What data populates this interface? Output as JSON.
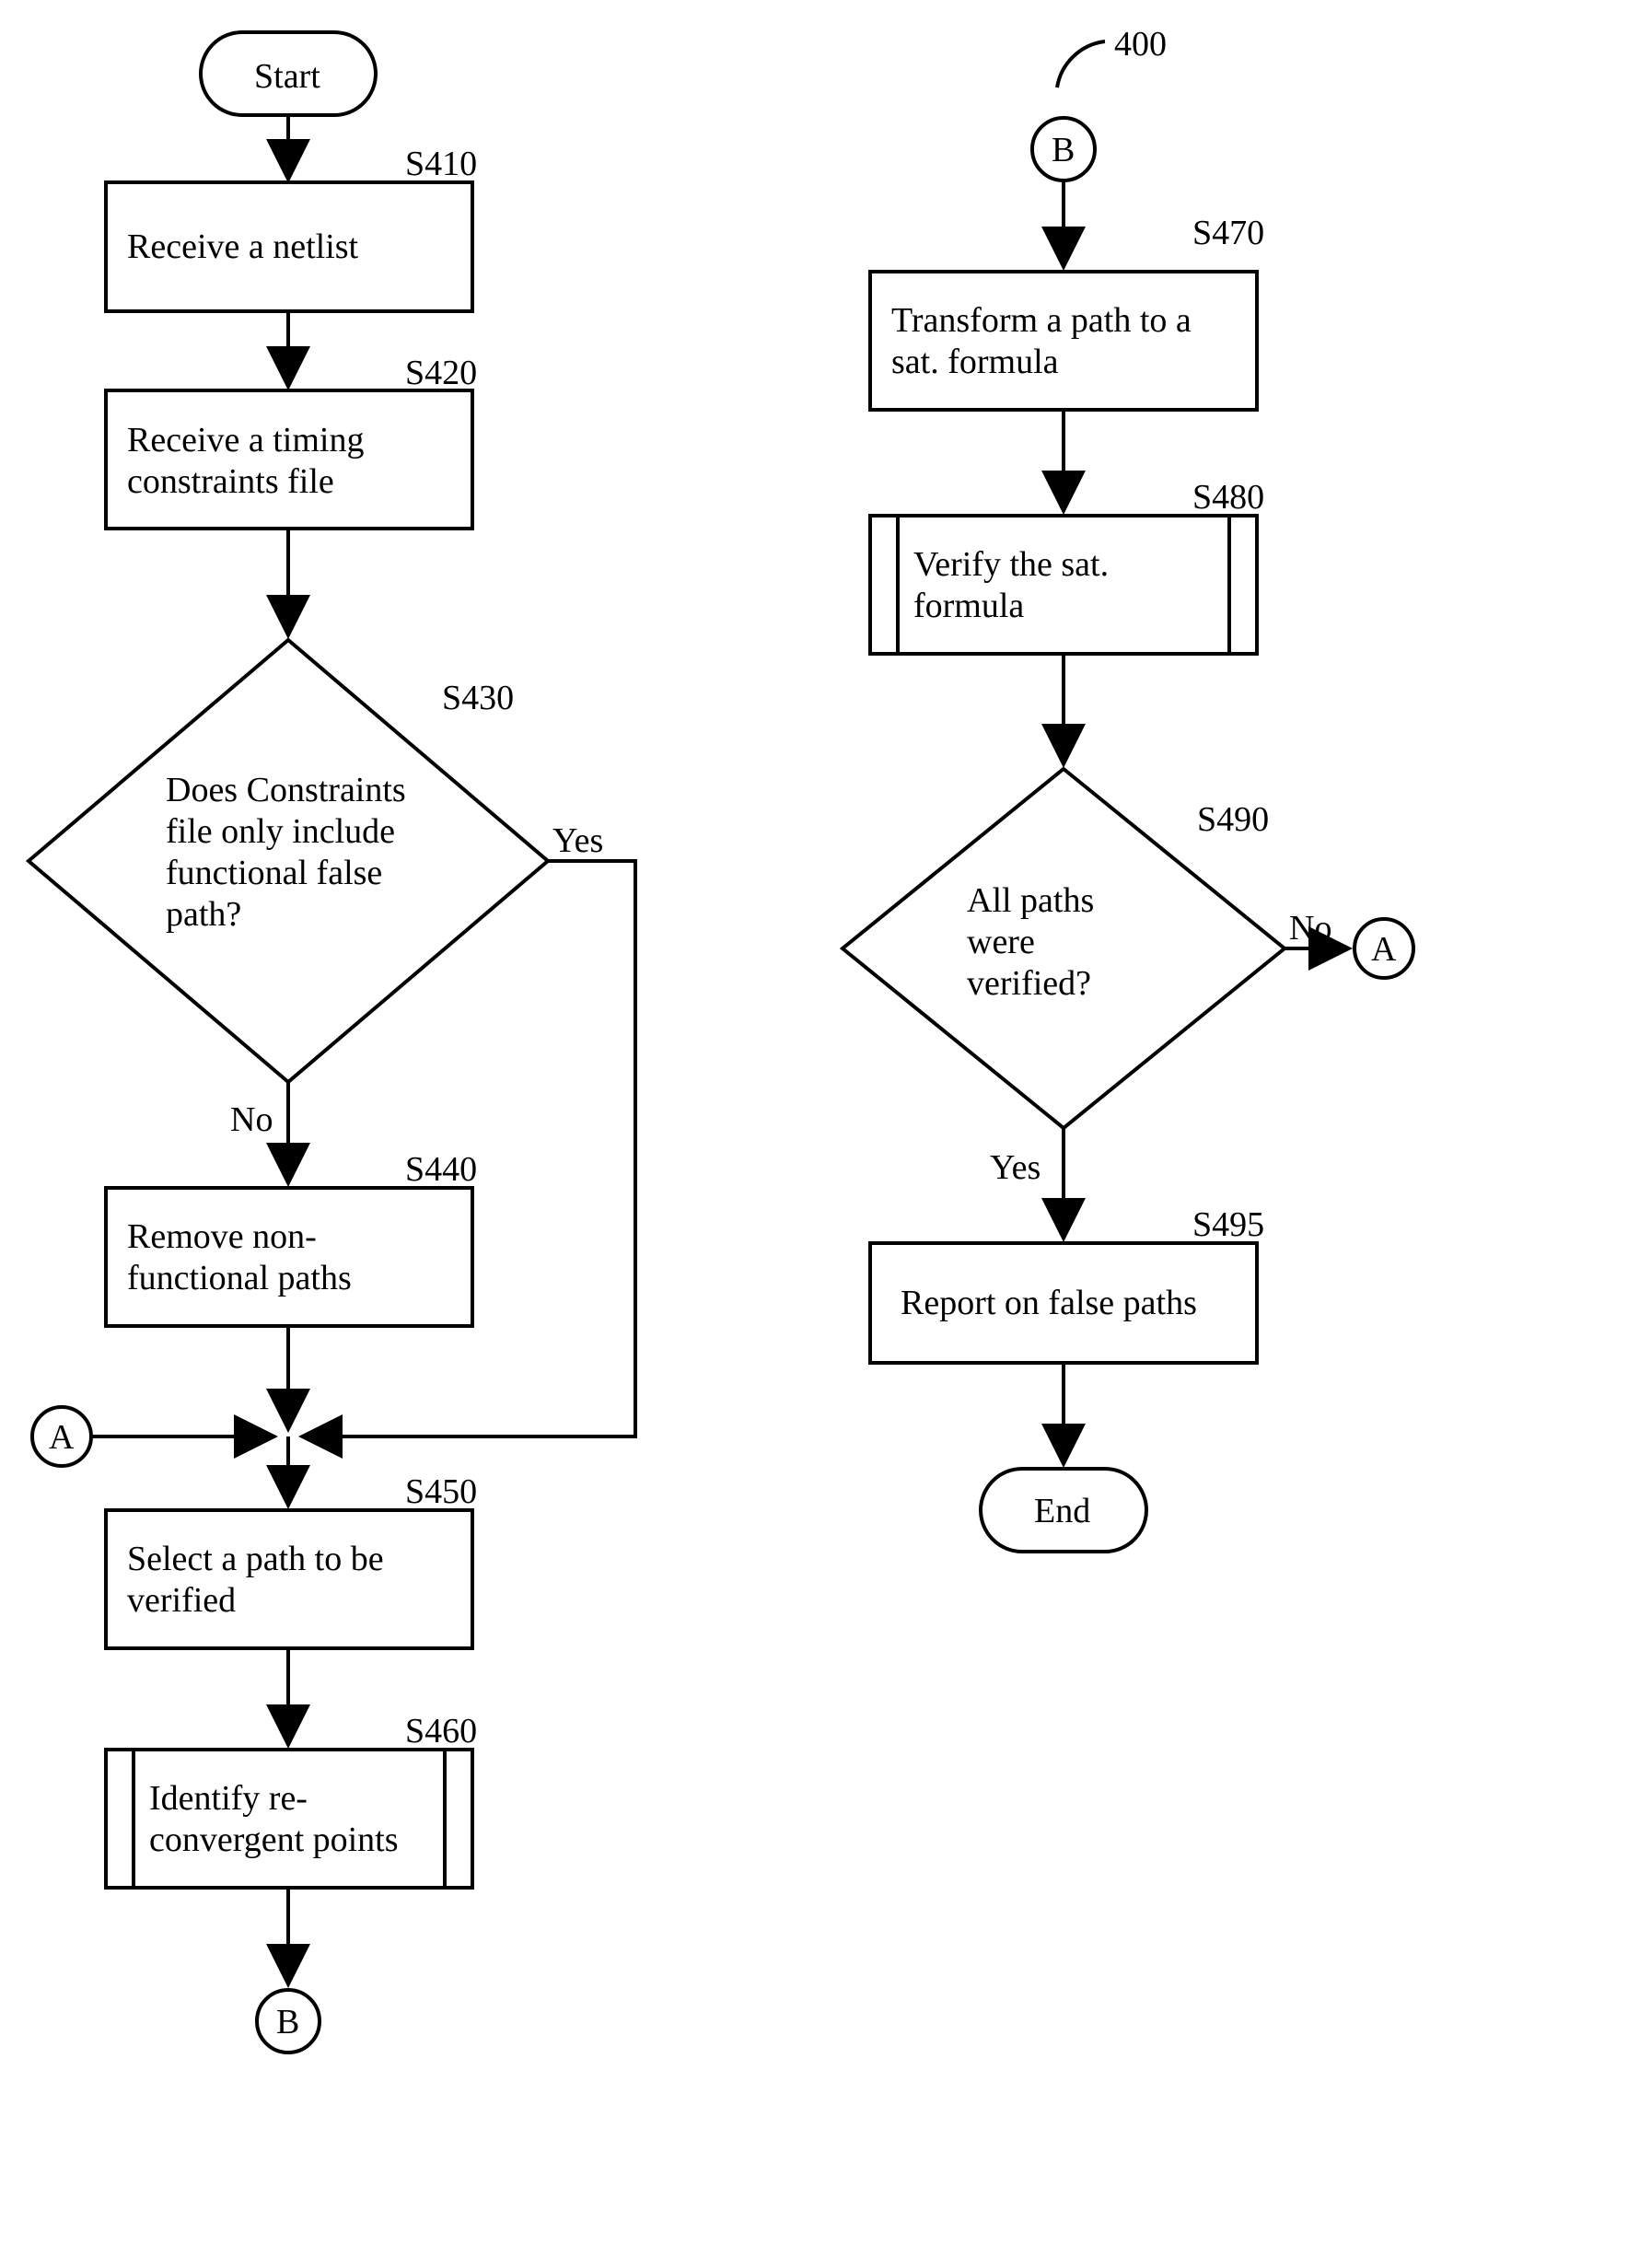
{
  "figure_label": "400",
  "start": "Start",
  "end": "End",
  "connectors": {
    "A": "A",
    "B": "B"
  },
  "steps": {
    "s410": {
      "label": "S410",
      "text1": "Receive a netlist"
    },
    "s420": {
      "label": "S420",
      "text1": "Receive a timing",
      "text2": "constraints file"
    },
    "s430": {
      "label": "S430",
      "text1": "Does Constraints",
      "text2": "file only include",
      "text3": "functional false",
      "text4": "path?"
    },
    "s440": {
      "label": "S440",
      "text1": "Remove non-",
      "text2": "functional paths"
    },
    "s450": {
      "label": "S450",
      "text1": "Select a path to be",
      "text2": "verified"
    },
    "s460": {
      "label": "S460",
      "text1": "Identify re-",
      "text2": "convergent points"
    },
    "s470": {
      "label": "S470",
      "text1": "Transform a path to a",
      "text2": "sat. formula"
    },
    "s480": {
      "label": "S480",
      "text1": "Verify the sat.",
      "text2": "formula"
    },
    "s490": {
      "label": "S490",
      "text1": "All paths",
      "text2": "were",
      "text3": "verified?"
    },
    "s495": {
      "label": "S495",
      "text1": "Report on false paths"
    }
  },
  "labels": {
    "yes": "Yes",
    "no": "No"
  }
}
